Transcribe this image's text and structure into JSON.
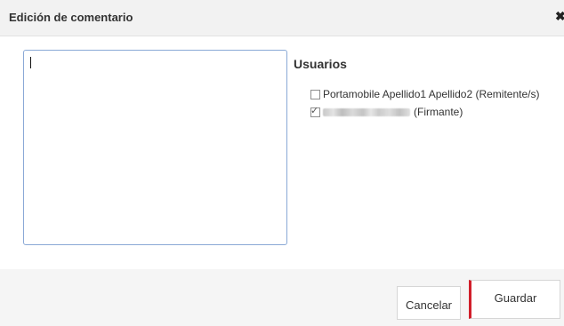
{
  "dialog": {
    "title": "Edición de comentario",
    "close_icon": "close-icon"
  },
  "comment": {
    "value": "",
    "placeholder": ""
  },
  "users": {
    "heading": "Usuarios",
    "items": [
      {
        "label": "Portamobile Apellido1 Apellido2 (Remitente/s)",
        "checked": false
      },
      {
        "label": "(Firmante)",
        "checked": true,
        "name_redacted": true
      }
    ]
  },
  "footer": {
    "cancel_label": "Cancelar",
    "save_label": "Guardar"
  },
  "colors": {
    "accent": "#d11e2a",
    "header_bg": "#f2f2f2",
    "input_border": "#8aa9d6"
  }
}
